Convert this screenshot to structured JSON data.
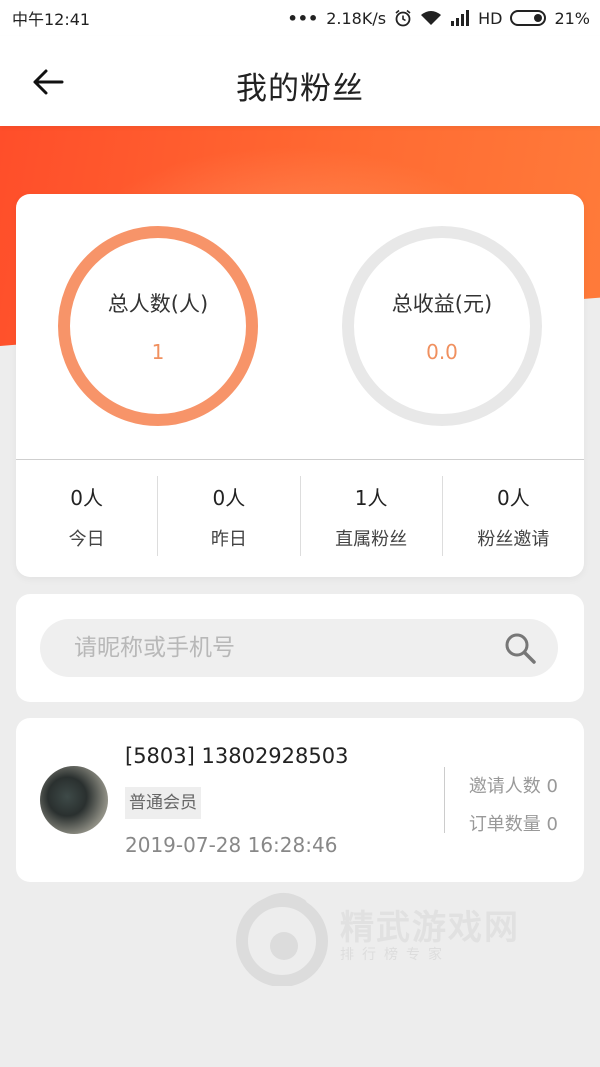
{
  "status_bar": {
    "time": "中午12:41",
    "dots": "•••",
    "speed": "2.18K/s",
    "network": "HD",
    "battery": "21%"
  },
  "header": {
    "title": "我的粉丝"
  },
  "summary": {
    "people_label": "总人数(人)",
    "people_value": "1",
    "income_label": "总收益(元)",
    "income_value": "0.0"
  },
  "stats": [
    {
      "value": "0人",
      "label": "今日"
    },
    {
      "value": "0人",
      "label": "昨日"
    },
    {
      "value": "1人",
      "label": "直属粉丝"
    },
    {
      "value": "0人",
      "label": "粉丝邀请"
    }
  ],
  "search": {
    "placeholder": "请昵称或手机号"
  },
  "members": [
    {
      "name": "[5803] 13802928503",
      "level": "普通会员",
      "joined": "2019-07-28 16:28:46",
      "invites": "邀请人数 0",
      "orders": "订单数量 0"
    }
  ],
  "watermark": {
    "text": "精武游戏网",
    "subtext": "排行榜专家"
  },
  "colors": {
    "accent": "#f79469",
    "banner": "#ff5a2e",
    "ring_inactive": "#e8e8e8"
  }
}
